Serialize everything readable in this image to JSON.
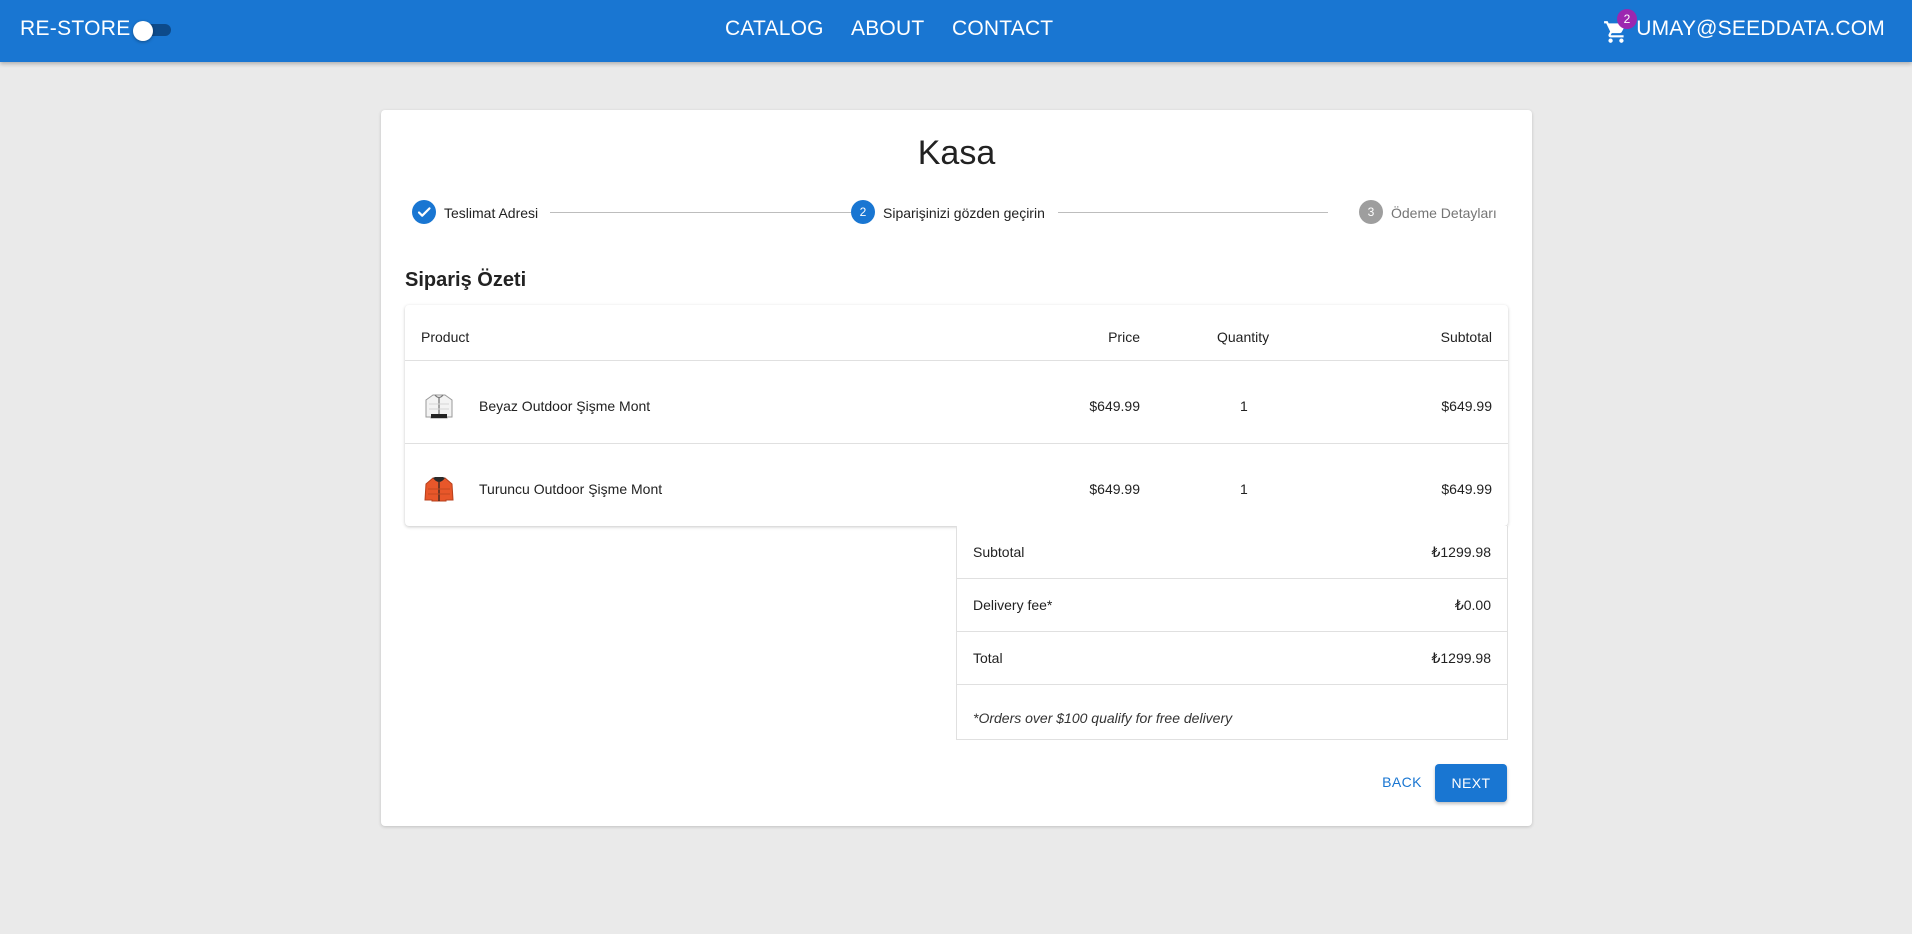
{
  "appbar": {
    "brand": "RE-STORE",
    "nav": [
      "CATALOG",
      "ABOUT",
      "CONTACT"
    ],
    "cart_count": "2",
    "user": "UMAY@SEEDDATA.COM",
    "color": "#1976d2"
  },
  "checkout": {
    "title": "Kasa",
    "steps": [
      {
        "index": "1",
        "label": "Teslimat Adresi",
        "state": "completed"
      },
      {
        "index": "2",
        "label": "Siparişinizi gözden geçirin",
        "state": "active"
      },
      {
        "index": "3",
        "label": "Ödeme Detayları",
        "state": "inactive"
      }
    ],
    "section_title": "Sipariş Özeti",
    "table": {
      "headers": {
        "product": "Product",
        "price": "Price",
        "quantity": "Quantity",
        "subtotal": "Subtotal"
      },
      "rows": [
        {
          "name": "Beyaz Outdoor Şişme Mont",
          "price": "$649.99",
          "quantity": "1",
          "subtotal": "$649.99",
          "image": "white-jacket-icon"
        },
        {
          "name": "Turuncu Outdoor Şişme Mont",
          "price": "$649.99",
          "quantity": "1",
          "subtotal": "$649.99",
          "image": "orange-jacket-icon"
        }
      ]
    },
    "summary": {
      "subtotal_label": "Subtotal",
      "subtotal_value": "₺1299.98",
      "delivery_label": "Delivery fee*",
      "delivery_value": "₺0.00",
      "total_label": "Total",
      "total_value": "₺1299.98",
      "note": "*Orders over $100 qualify for free delivery"
    },
    "buttons": {
      "back": "BACK",
      "next": "NEXT"
    }
  }
}
